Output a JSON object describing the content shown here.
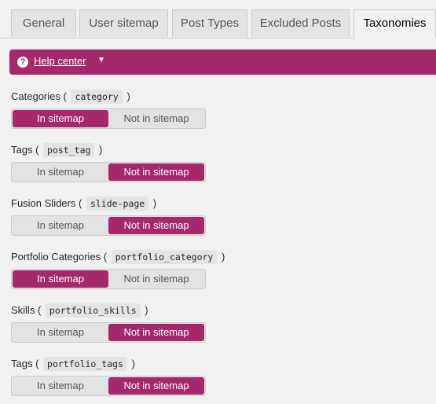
{
  "tabs": [
    {
      "label": "General",
      "active": false
    },
    {
      "label": "User sitemap",
      "active": false
    },
    {
      "label": "Post Types",
      "active": false
    },
    {
      "label": "Excluded Posts",
      "active": false
    },
    {
      "label": "Taxonomies",
      "active": true
    }
  ],
  "help": {
    "label": "Help center",
    "icon": "question-icon",
    "caret": "caret-down-icon"
  },
  "toggle_labels": {
    "on": "In sitemap",
    "off": "Not in sitemap"
  },
  "taxonomies": [
    {
      "name": "Categories",
      "slug": "category",
      "in_sitemap": true
    },
    {
      "name": "Tags",
      "slug": "post_tag",
      "in_sitemap": false
    },
    {
      "name": "Fusion Sliders",
      "slug": "slide-page",
      "in_sitemap": false
    },
    {
      "name": "Portfolio Categories",
      "slug": "portfolio_category",
      "in_sitemap": true
    },
    {
      "name": "Skills",
      "slug": "portfolio_skills",
      "in_sitemap": false
    },
    {
      "name": "Tags",
      "slug": "portfolio_tags",
      "in_sitemap": false
    }
  ],
  "colors": {
    "accent": "#a4286a",
    "background": "#f1f1f1"
  }
}
